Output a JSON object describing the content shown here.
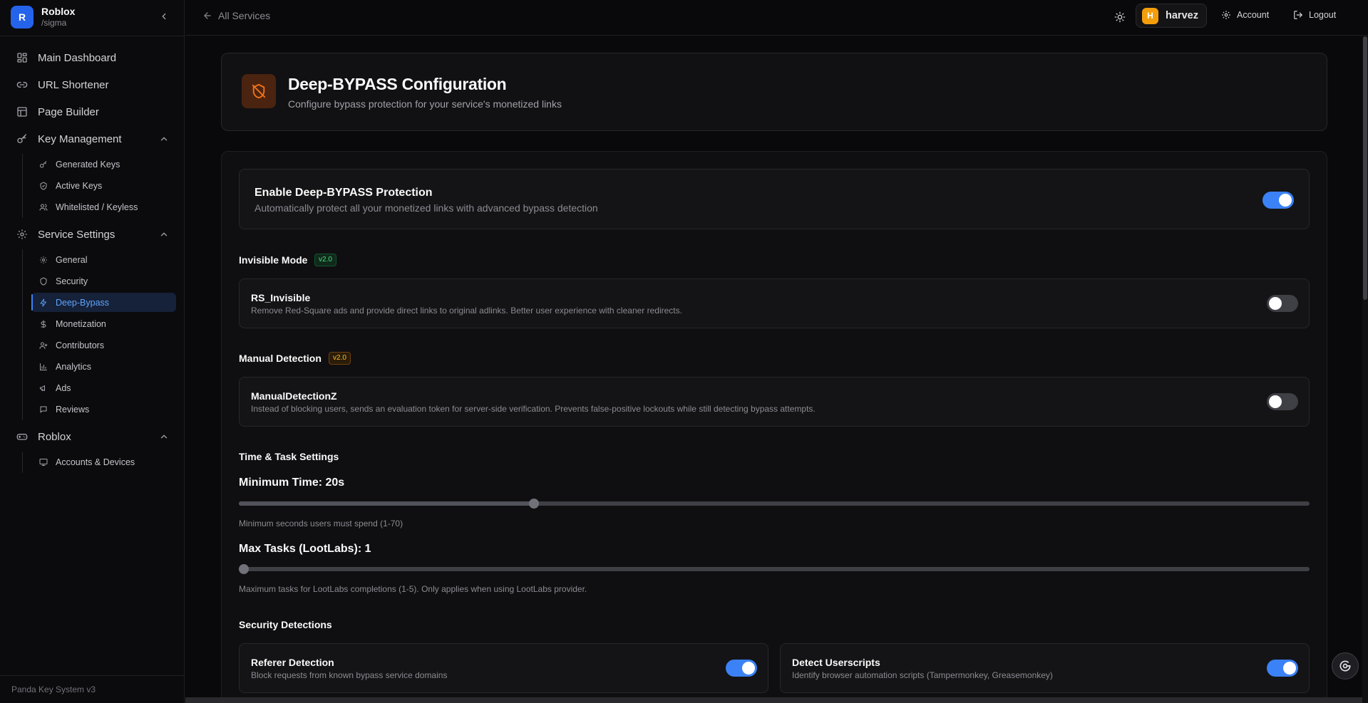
{
  "brand": {
    "initial": "R",
    "name": "Roblox",
    "slug": "/sigma"
  },
  "nav": {
    "main_dashboard": "Main Dashboard",
    "url_shortener": "URL Shortener",
    "page_builder": "Page Builder",
    "key_management": {
      "label": "Key Management",
      "items": [
        "Generated Keys",
        "Active Keys",
        "Whitelisted / Keyless"
      ]
    },
    "service_settings": {
      "label": "Service Settings",
      "items": [
        "General",
        "Security",
        "Deep-Bypass",
        "Monetization",
        "Contributors",
        "Analytics",
        "Ads",
        "Reviews"
      ],
      "active": "Deep-Bypass"
    },
    "roblox": {
      "label": "Roblox",
      "items": [
        "Accounts & Devices"
      ]
    }
  },
  "footer": {
    "version": "Panda Key System v3"
  },
  "topbar": {
    "back_label": "All Services",
    "user_initial": "H",
    "user_name": "harvez",
    "account_label": "Account",
    "logout_label": "Logout"
  },
  "header": {
    "title": "Deep-BYPASS Configuration",
    "subtitle": "Configure bypass protection for your service's monetized links"
  },
  "enable": {
    "title": "Enable Deep-BYPASS Protection",
    "desc": "Automatically protect all your monetized links with advanced bypass detection",
    "on": true
  },
  "invisible": {
    "section": "Invisible Mode",
    "badge": "v2.0",
    "title": "RS_Invisible",
    "desc": "Remove Red-Square ads and provide direct links to original adlinks. Better user experience with cleaner redirects.",
    "on": false
  },
  "manual": {
    "section": "Manual Detection",
    "badge": "v2.0",
    "title": "ManualDetectionZ",
    "desc": "Instead of blocking users, sends an evaluation token for server-side verification. Prevents false-positive lockouts while still detecting bypass attempts.",
    "on": false
  },
  "time_task": {
    "section": "Time & Task Settings",
    "min_time_label": "Minimum Time: 20s",
    "min_time": {
      "value": 20,
      "min": 1,
      "max": 70
    },
    "min_time_help": "Minimum seconds users must spend (1-70)",
    "max_tasks_label": "Max Tasks (LootLabs): 1",
    "max_tasks": {
      "value": 1,
      "min": 1,
      "max": 5
    },
    "max_tasks_help": "Maximum tasks for LootLabs completions (1-5). Only applies when using LootLabs provider."
  },
  "security": {
    "section": "Security Detections",
    "referer": {
      "title": "Referer Detection",
      "desc": "Block requests from known bypass service domains",
      "on": true
    },
    "userscripts": {
      "title": "Detect Userscripts",
      "desc": "Identify browser automation scripts (Tampermonkey, Greasemonkey)",
      "on": true
    }
  },
  "colors": {
    "accent": "#3b82f6",
    "brand": "#2563eb",
    "header_icon": "#f97316",
    "avatar": "#f59e0b"
  }
}
